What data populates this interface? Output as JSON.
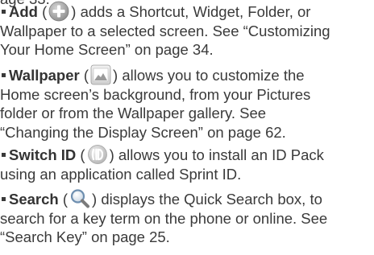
{
  "partial_top_line": "age 33.",
  "items": [
    {
      "term": "Add",
      "icon": "add-plus-circle-icon",
      "lines": [
        [
          ") adds a Shortcut, Widget, Folder, or"
        ],
        [
          "Wallpaper to a selected screen. See “Customizing"
        ],
        [
          "Your Home Screen” on page 34."
        ]
      ]
    },
    {
      "term": "Wallpaper",
      "icon": "wallpaper-landscape-icon",
      "lines": [
        [
          ") allows you to customize the"
        ],
        [
          "Home screen’s background, from your Pictures"
        ],
        [
          "folder or from the Wallpaper gallery. See"
        ],
        [
          "“Changing the Display Screen” on page 62."
        ]
      ]
    },
    {
      "term": "Switch ID",
      "icon": "switch-id-icon",
      "lines": [
        [
          ") allows you to install an ID Pack"
        ],
        [
          "using an application called Sprint ID."
        ]
      ]
    },
    {
      "term": "Search",
      "icon": "search-magnifier-icon",
      "lines": [
        [
          ") displays the Quick Search box, to"
        ],
        [
          "search for a key term on the phone or online. See"
        ],
        [
          "“Search Key” on page 25."
        ]
      ]
    }
  ],
  "colors": {
    "text": "#3a3a3a",
    "icon_gray_dark": "#8a8a8a",
    "icon_gray_light": "#e4e4e4",
    "icon_blue": "#7aa7cf"
  }
}
